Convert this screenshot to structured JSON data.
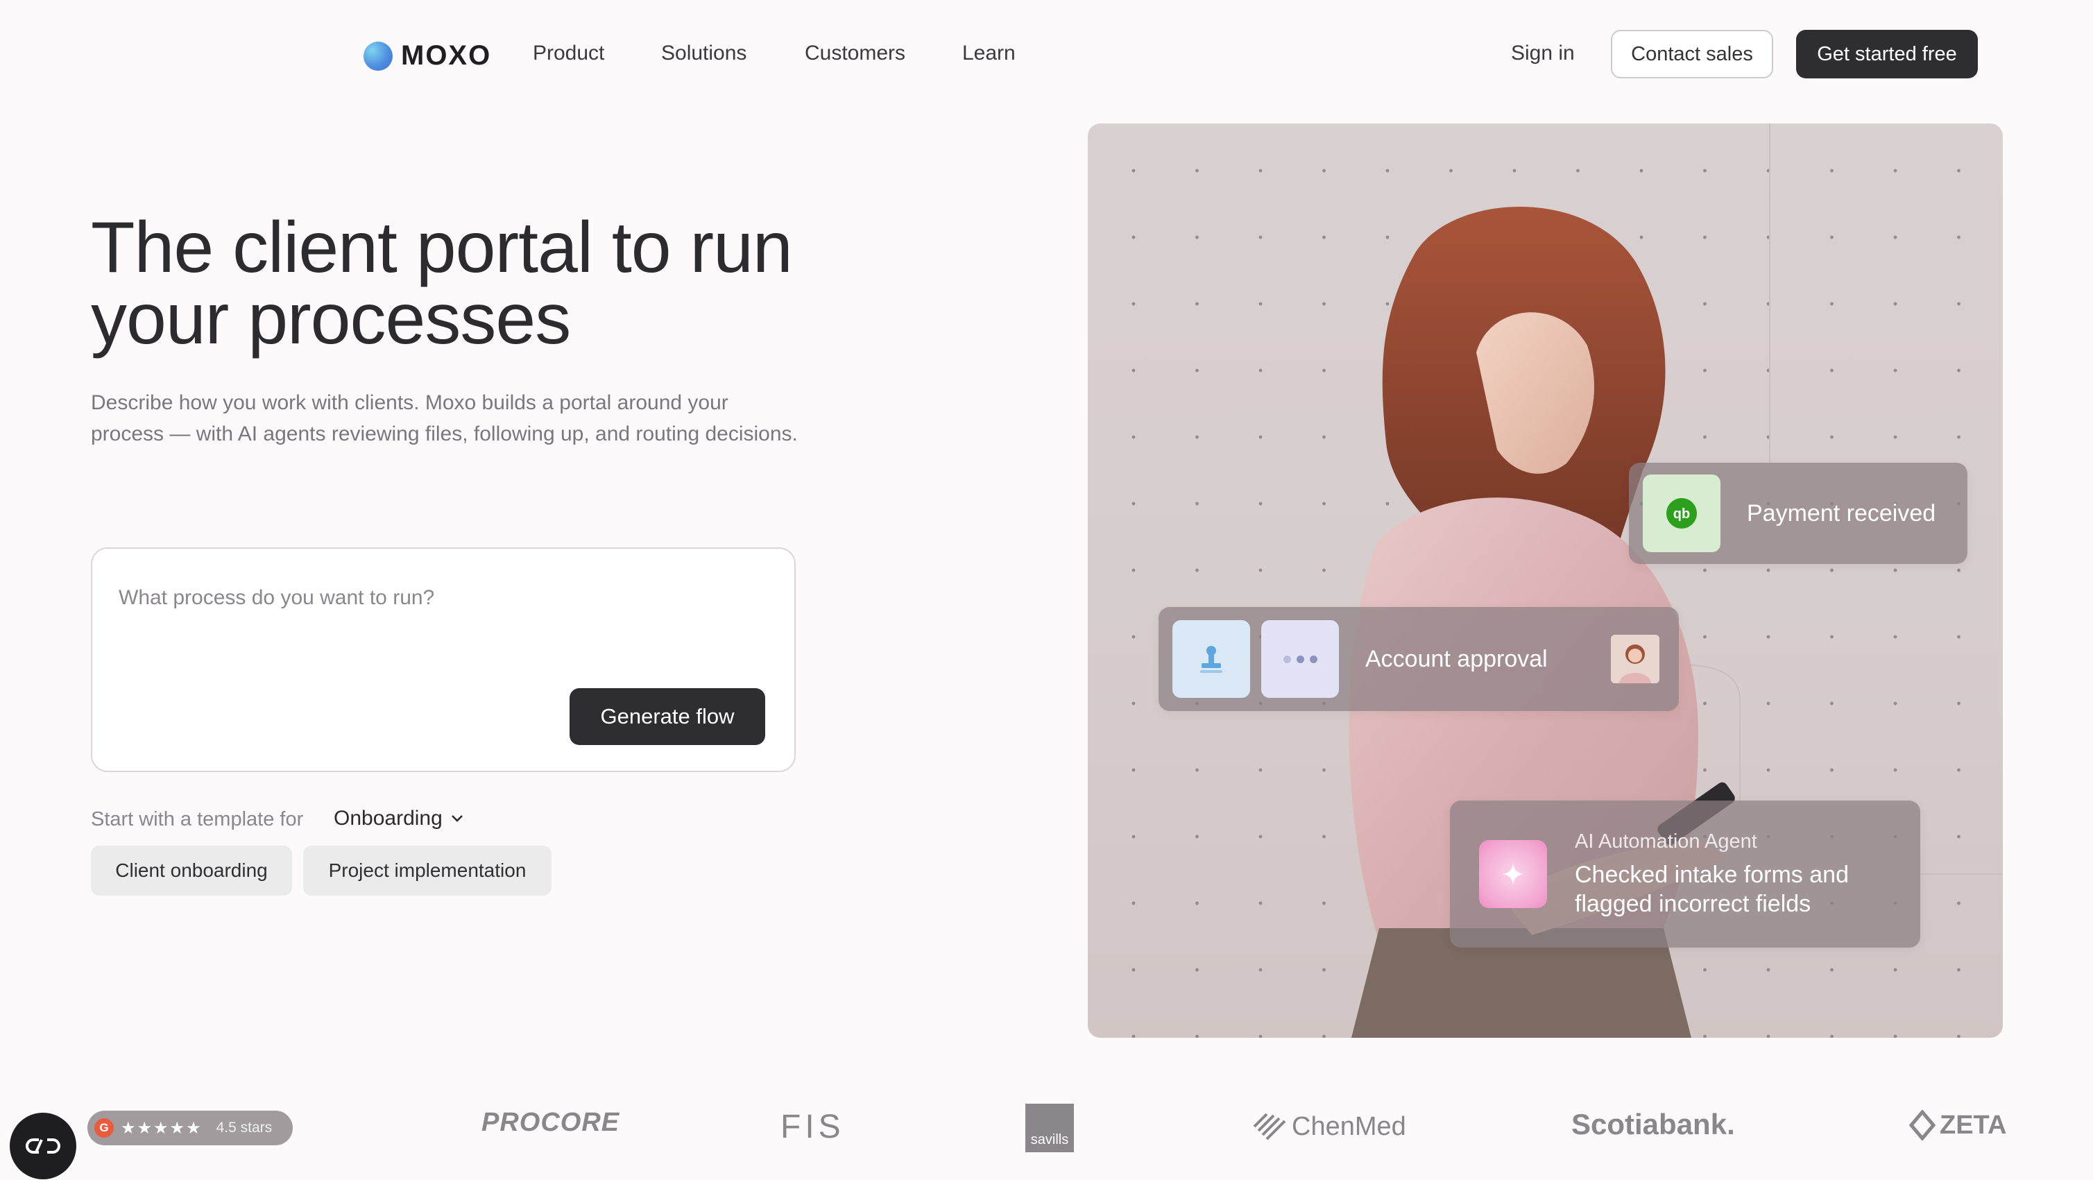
{
  "nav": {
    "logo_text": "MOXO",
    "items": [
      "Product",
      "Solutions",
      "Customers",
      "Learn"
    ],
    "sign_in": "Sign in",
    "contact_sales": "Contact sales",
    "get_started": "Get started free"
  },
  "hero": {
    "title_line1": "The client portal to run",
    "title_line2": "your processes",
    "description": "Describe how you work with clients. Moxo builds a portal around your process — with AI agents reviewing files, following up, and routing decisions.",
    "prompt_placeholder": "What process do you want to run?",
    "generate_label": "Generate flow",
    "template_label": "Start with a template for",
    "template_selected": "Onboarding",
    "chips": [
      "Client onboarding",
      "Project implementation"
    ]
  },
  "cards": {
    "payment": "Payment received",
    "account": "Account approval",
    "ai_title": "AI Automation Agent",
    "ai_message": "Checked intake forms and flagged incorrect fields"
  },
  "trust": {
    "g2_badge": "G",
    "g2_stars": "★★★★★",
    "g2_rating": "4.5 stars",
    "logos": [
      "PROCORE",
      "FIS",
      "savills",
      "ChenMed",
      "Scotiabank.",
      "ZETA"
    ]
  },
  "colors": {
    "background": "#fcfafb",
    "dark_button": "#2e2d2f",
    "g2_orange": "#ea5a3d",
    "quickbooks_green": "#2ca01c",
    "ai_pink": "#f3a7d1"
  }
}
